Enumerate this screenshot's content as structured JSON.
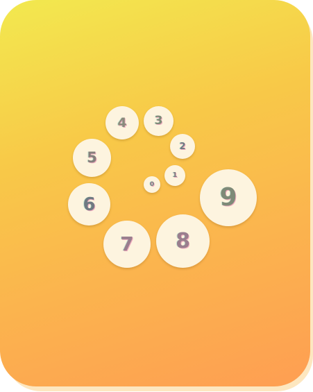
{
  "dial": {
    "buttons": [
      {
        "label": "0"
      },
      {
        "label": "1"
      },
      {
        "label": "2"
      },
      {
        "label": "3"
      },
      {
        "label": "4"
      },
      {
        "label": "5"
      },
      {
        "label": "6"
      },
      {
        "label": "7"
      },
      {
        "label": "8"
      },
      {
        "label": "9"
      }
    ]
  },
  "colors": {
    "gradient_top": "#f2e94f",
    "gradient_bottom": "#fe9e52",
    "bubble_fill": "#fdf4df",
    "digit_gray": "#8a8a7c",
    "digit_blue_gray": "#6f7a82",
    "digit_purple": "#9a7e8e"
  }
}
